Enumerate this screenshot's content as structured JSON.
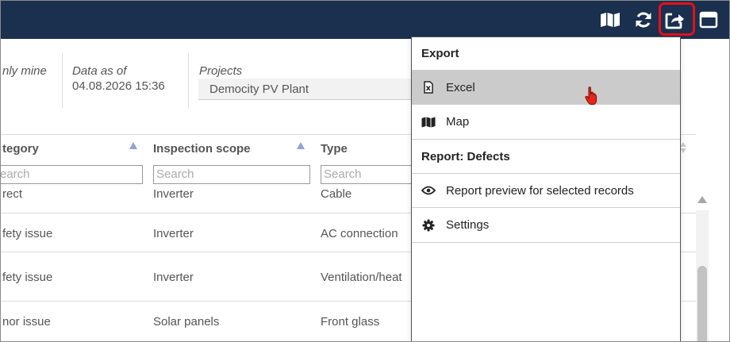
{
  "toolbar": {
    "icons": [
      "map-icon",
      "refresh-icon",
      "export-icon",
      "window-icon"
    ],
    "highlight_color": "#e3101a",
    "bar_color": "#1b2f4e"
  },
  "filters": {
    "only_mine_text": "nly mine",
    "data_as_of_label": "Data as of",
    "data_as_of_value": "04.08.2026 15:36",
    "projects_label": "Projects",
    "projects_value": "Democity PV Plant"
  },
  "table": {
    "columns": [
      {
        "label": "tegory",
        "search_placeholder": "earch"
      },
      {
        "label": "Inspection scope",
        "search_placeholder": "Search"
      },
      {
        "label": "Type",
        "search_placeholder": "Search"
      }
    ],
    "rows": [
      [
        "rect",
        "Inverter",
        "Cable"
      ],
      [
        "fety issue",
        "Inverter",
        "AC connection"
      ],
      [
        "fety issue",
        "Inverter",
        "Ventilation/heat"
      ],
      [
        "nor issue",
        "Solar panels",
        "Front glass"
      ]
    ]
  },
  "menu": {
    "export_header": "Export",
    "excel_label": "Excel",
    "map_label": "Map",
    "report_header": "Report: Defects",
    "report_preview_label": "Report preview for selected records",
    "settings_label": "Settings"
  }
}
